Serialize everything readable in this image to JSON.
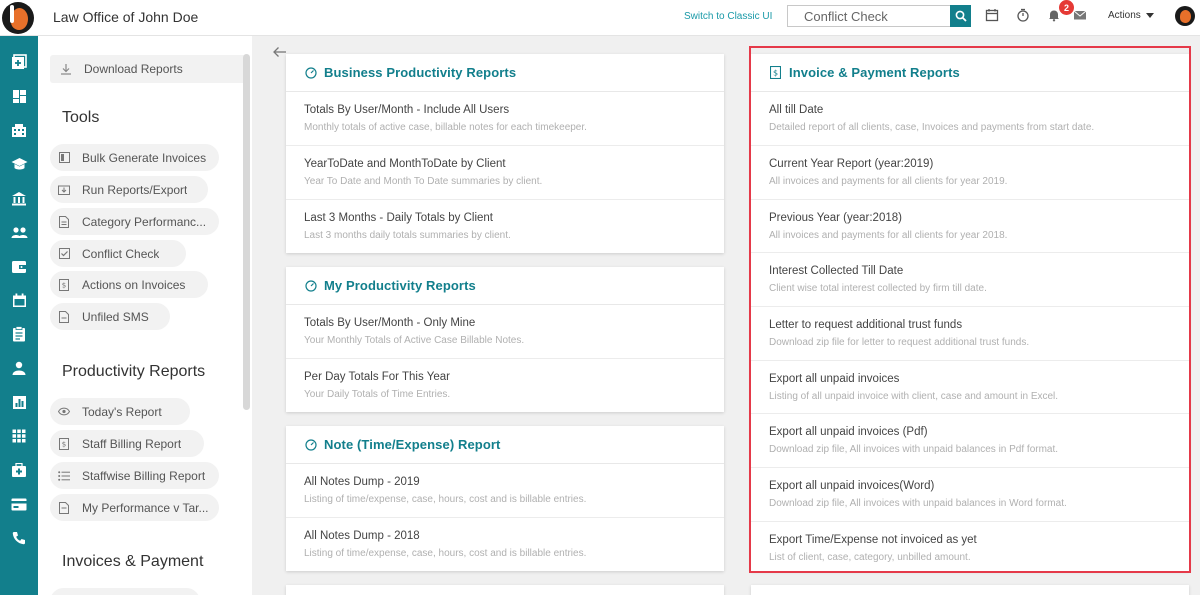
{
  "header": {
    "title": "Law Office of John Doe",
    "switch_label": "Switch to Classic UI",
    "search_placeholder": "Conflict Check",
    "notification_count": "2",
    "actions_label": "Actions"
  },
  "rail_icons": [
    "add-icon",
    "dashboard-icon",
    "building-icon",
    "graduation-cap-icon",
    "bank-icon",
    "users-icon",
    "wallet-icon",
    "calendar-icon",
    "clipboard-icon",
    "person-icon",
    "chart-icon",
    "grid-icon",
    "medical-box-icon",
    "card-icon",
    "phone-icon"
  ],
  "left_panel": {
    "download_reports": "Download Reports",
    "tools_heading": "Tools",
    "tools": [
      "Bulk Generate Invoices",
      "Run Reports/Export",
      "Category Performanc...",
      "Conflict Check",
      "Actions on Invoices",
      "Unfiled SMS"
    ],
    "productivity_heading": "Productivity Reports",
    "productivity": [
      "Today's Report",
      "Staff Billing Report",
      "Staffwise Billing Report",
      "My Performance v Tar..."
    ],
    "invoices_heading": "Invoices & Payment"
  },
  "cards": {
    "business": {
      "title": "Business Productivity Reports",
      "rows": [
        {
          "title": "Totals By User/Month - Include All Users",
          "subtitle": "Monthly totals of active case, billable notes for each timekeeper."
        },
        {
          "title": "YearToDate and MonthToDate by Client",
          "subtitle": "Year To Date and Month To Date summaries by client."
        },
        {
          "title": "Last 3 Months - Daily Totals by Client",
          "subtitle": "Last 3 months daily totals summaries by client."
        }
      ]
    },
    "my_productivity": {
      "title": "My Productivity Reports",
      "rows": [
        {
          "title": "Totals By User/Month - Only Mine",
          "subtitle": "Your Monthly Totals of Active Case Billable Notes."
        },
        {
          "title": "Per Day Totals For This Year",
          "subtitle": "Your Daily Totals of Time Entries."
        }
      ]
    },
    "note": {
      "title": "Note (Time/Expense) Report",
      "rows": [
        {
          "title": "All Notes Dump - 2019",
          "subtitle": "Listing of time/expense, case, hours, cost and is billable entries."
        },
        {
          "title": "All Notes Dump - 2018",
          "subtitle": "Listing of time/expense, case, hours, cost and is billable entries."
        }
      ]
    },
    "invoice": {
      "title": "Invoice & Payment Reports",
      "rows": [
        {
          "title": "All till Date",
          "subtitle": "Detailed report of all clients, case, Invoices and payments from start date."
        },
        {
          "title": "Current Year Report (year:2019)",
          "subtitle": "All invoices and payments for all clients for year 2019."
        },
        {
          "title": "Previous Year (year:2018)",
          "subtitle": "All invoices and payments for all clients for year 2018."
        },
        {
          "title": "Interest Collected Till Date",
          "subtitle": "Client wise total interest collected by firm till date."
        },
        {
          "title": "Letter to request additional trust funds",
          "subtitle": "Download zip file for letter to request additional trust funds."
        },
        {
          "title": "Export all unpaid invoices",
          "subtitle": "Listing of all unpaid invoice with client, case and amount in Excel."
        },
        {
          "title": "Export all unpaid invoices (Pdf)",
          "subtitle": "Download zip file, All invoices with unpaid balances in Pdf format."
        },
        {
          "title": "Export all unpaid invoices(Word)",
          "subtitle": "Download zip file, All invoices with unpaid balances in Word format."
        },
        {
          "title": "Export Time/Expense not invoiced as yet",
          "subtitle": "List of client, case, category, unbilled amount."
        }
      ]
    }
  },
  "colors": {
    "brand": "#127f8c",
    "highlight": "#e53949",
    "badge": "#e53935"
  }
}
